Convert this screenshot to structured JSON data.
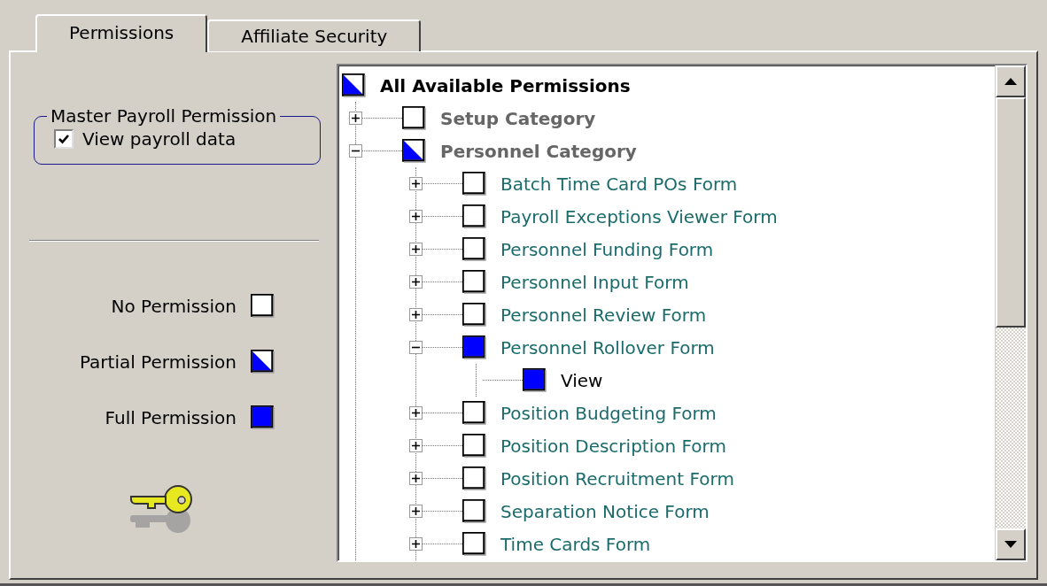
{
  "tabs": [
    {
      "label": "Permissions",
      "selected": true
    },
    {
      "label": "Affiliate Security",
      "selected": false
    }
  ],
  "master_payroll_permission": {
    "title": "Master Payroll Permission",
    "checkbox": {
      "label": "View payroll data",
      "checked": true
    }
  },
  "legend": [
    {
      "label": "No Permission",
      "checked": false,
      "partial": false
    },
    {
      "label": "Partial Permission",
      "checked": false,
      "partial": true
    },
    {
      "label": "Full Permission",
      "checked": true,
      "partial": false
    }
  ],
  "tree": {
    "label": "All Available Permissions",
    "kind": "root",
    "checked": false,
    "partial": true,
    "children": [
      {
        "label": "Setup Category",
        "kind": "category",
        "checked": false,
        "partial": false,
        "expanded": false
      },
      {
        "label": "Personnel Category",
        "kind": "category",
        "checked": false,
        "partial": true,
        "expanded": true,
        "children": [
          {
            "label": "Batch Time Card POs Form",
            "kind": "form",
            "checked": false,
            "partial": false,
            "expanded": false
          },
          {
            "label": "Payroll Exceptions Viewer Form",
            "kind": "form",
            "checked": false,
            "partial": false,
            "expanded": false
          },
          {
            "label": "Personnel Funding Form",
            "kind": "form",
            "checked": false,
            "partial": false,
            "expanded": false
          },
          {
            "label": "Personnel Input Form",
            "kind": "form",
            "checked": false,
            "partial": false,
            "expanded": false
          },
          {
            "label": "Personnel Review Form",
            "kind": "form",
            "checked": false,
            "partial": false,
            "expanded": false
          },
          {
            "label": "Personnel Rollover Form",
            "kind": "form",
            "checked": true,
            "partial": false,
            "expanded": true,
            "children": [
              {
                "label": "View",
                "kind": "action",
                "checked": true,
                "partial": false
              }
            ]
          },
          {
            "label": "Position Budgeting Form",
            "kind": "form",
            "checked": false,
            "partial": false,
            "expanded": false
          },
          {
            "label": "Position Description Form",
            "kind": "form",
            "checked": false,
            "partial": false,
            "expanded": false
          },
          {
            "label": "Position Recruitment Form",
            "kind": "form",
            "checked": false,
            "partial": false,
            "expanded": false
          },
          {
            "label": "Separation Notice Form",
            "kind": "form",
            "checked": false,
            "partial": false,
            "expanded": false
          },
          {
            "label": "Time Cards Form",
            "kind": "form",
            "checked": false,
            "partial": false,
            "expanded": false
          }
        ]
      }
    ]
  }
}
